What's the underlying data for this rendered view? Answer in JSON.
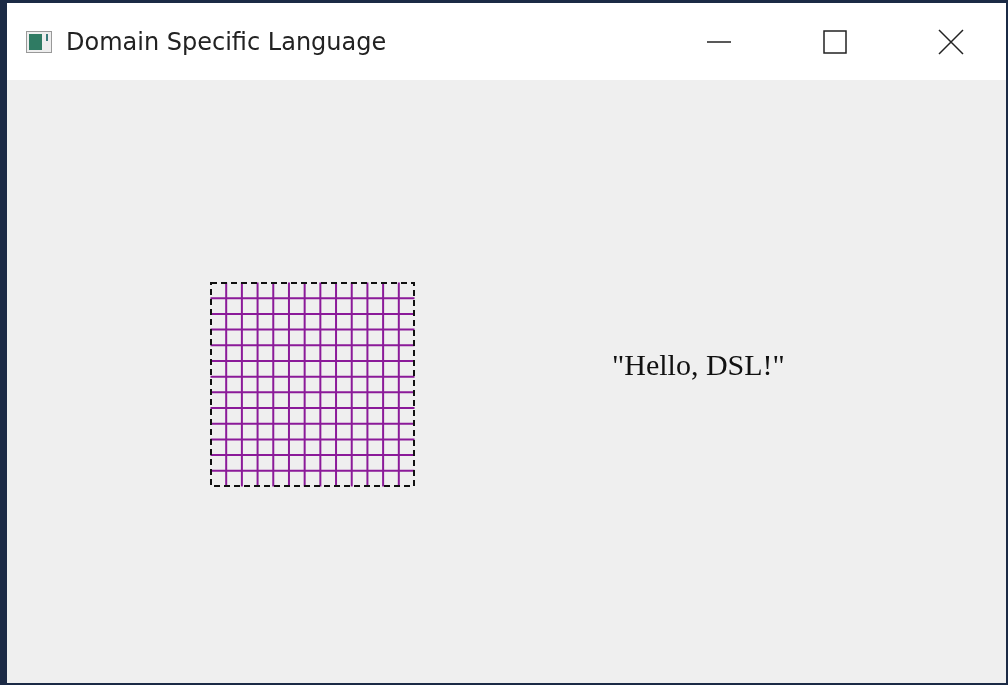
{
  "window": {
    "title": "Domain Specific Language"
  },
  "canvas": {
    "label": "\"Hello, DSL!\""
  }
}
